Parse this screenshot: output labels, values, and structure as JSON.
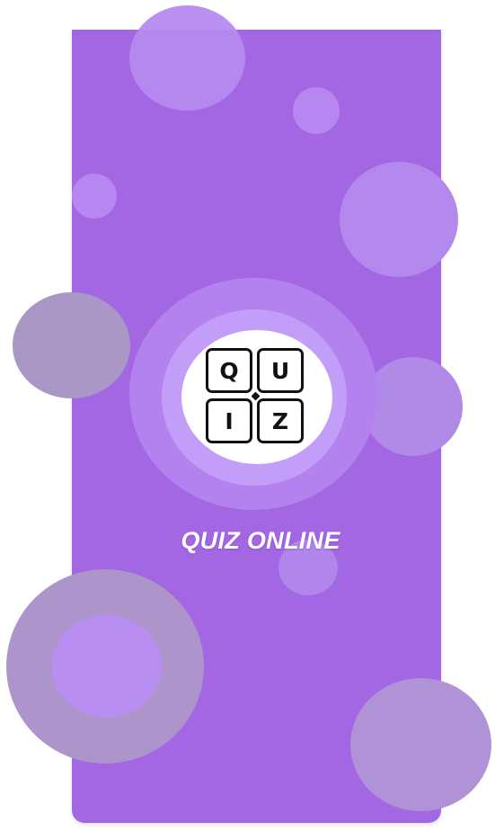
{
  "app": {
    "title": "QUIZ ONLINE",
    "logo_letters": [
      "Q",
      "U",
      "I",
      "Z"
    ]
  },
  "colors": {
    "card_background": "#a467e4",
    "bubble_on_card": "#b687f0",
    "bubble_off_card": "#aa9dbd",
    "logo_ring_outer": "#b382ee",
    "logo_ring_mid": "#c39ef8",
    "logo_ring_inner": "#ffffff",
    "title_text": "#ffffff"
  },
  "icons": {
    "logo": "quiz-tiles-icon"
  }
}
